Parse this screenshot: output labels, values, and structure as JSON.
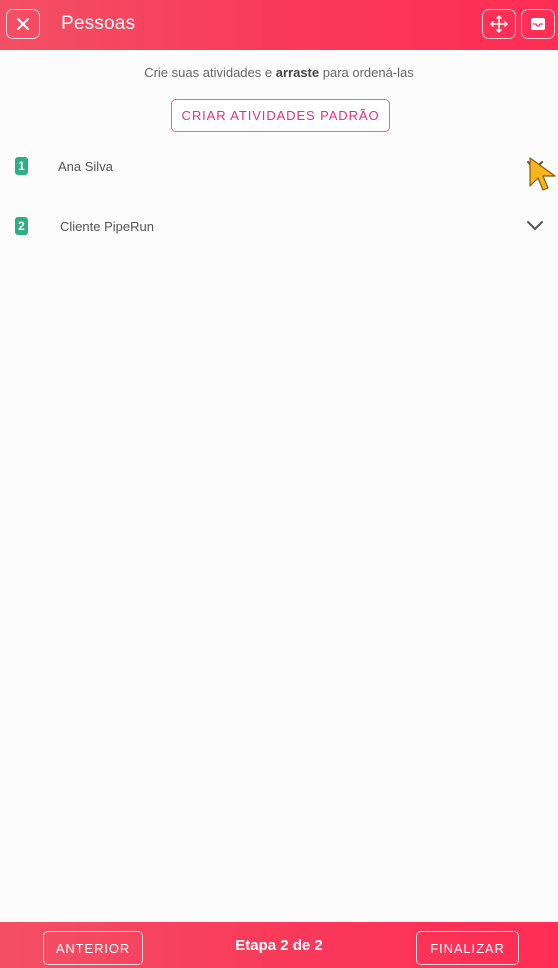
{
  "header": {
    "title": "Pessoas",
    "close_icon": "close-icon",
    "move_icon": "move-arrows-icon",
    "inbox_icon": "inbox-icon",
    "gradient_start": "#f34f64",
    "gradient_end": "#ff2d55"
  },
  "instruction": {
    "prefix": "Crie suas atividades e",
    "bold": "arraste",
    "suffix": "para ordená-las"
  },
  "default_button": {
    "label": "CRIAR ATIVIDADES PADRÃO",
    "color": "#e62f7f"
  },
  "activities": [
    {
      "number": "1",
      "label": "Ana Silva"
    },
    {
      "number": "2",
      "label": "Cliente PipeRun"
    }
  ],
  "footer": {
    "previous_label": "ANTERIOR",
    "step_label": "Etapa 2 de 2",
    "finish_label": "FINALIZAR"
  }
}
